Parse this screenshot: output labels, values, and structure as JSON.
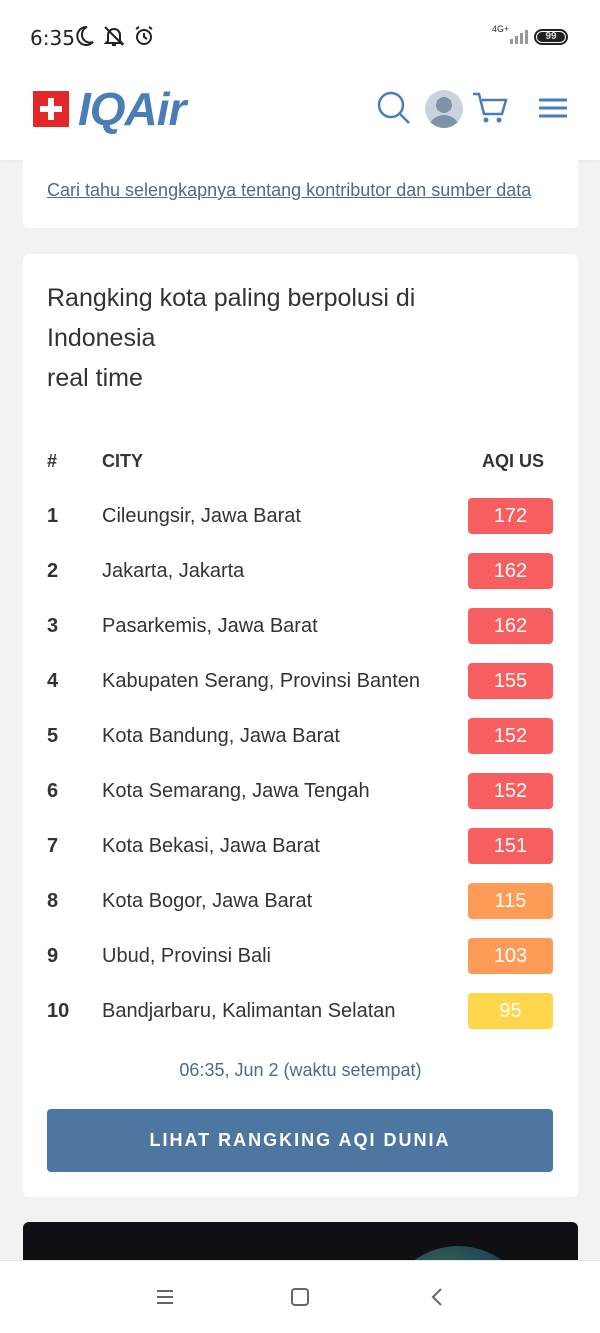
{
  "status_bar": {
    "time": "6:35",
    "network": "4G+",
    "battery": "99"
  },
  "header": {
    "logo_text": "IQAir",
    "icons": [
      "search-icon",
      "avatar",
      "cart-icon",
      "menu-icon"
    ]
  },
  "contributors": {
    "link_text": "Cari tahu selengkapnya tentang kontributor dan sumber data"
  },
  "ranking": {
    "title_line1": "Rangking kota paling berpolusi di",
    "title_line2": "Indonesia",
    "title_line3": "real time",
    "columns": {
      "rank": "#",
      "city": "CITY",
      "aqi": "AQI US"
    },
    "rows": [
      {
        "rank": "1",
        "city": "Cileungsir, Jawa Barat",
        "aqi": "172",
        "color": "#f65e5f"
      },
      {
        "rank": "2",
        "city": "Jakarta, Jakarta",
        "aqi": "162",
        "color": "#f65e5f"
      },
      {
        "rank": "3",
        "city": "Pasarkemis, Jawa Barat",
        "aqi": "162",
        "color": "#f65e5f"
      },
      {
        "rank": "4",
        "city": "Kabupaten Serang, Provinsi Banten",
        "aqi": "155",
        "color": "#f65e5f"
      },
      {
        "rank": "5",
        "city": "Kota Bandung, Jawa Barat",
        "aqi": "152",
        "color": "#f65e5f"
      },
      {
        "rank": "6",
        "city": "Kota Semarang, Jawa Tengah",
        "aqi": "152",
        "color": "#f65e5f"
      },
      {
        "rank": "7",
        "city": "Kota Bekasi, Jawa Barat",
        "aqi": "151",
        "color": "#f65e5f"
      },
      {
        "rank": "8",
        "city": "Kota Bogor, Jawa Barat",
        "aqi": "115",
        "color": "#fe9b57"
      },
      {
        "rank": "9",
        "city": "Ubud, Provinsi Bali",
        "aqi": "103",
        "color": "#fe9b57"
      },
      {
        "rank": "10",
        "city": "Bandjarbaru, Kalimantan Selatan",
        "aqi": "95",
        "color": "#fdd64b"
      }
    ],
    "timestamp": "06:35, Jun 2 (waktu setempat)",
    "world_button": "LIHAT RANGKING AQI DUNIA"
  }
}
